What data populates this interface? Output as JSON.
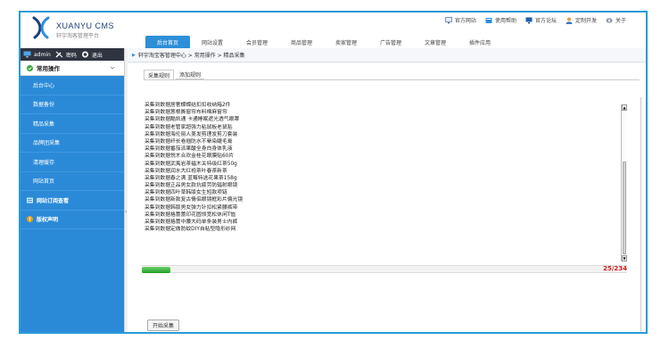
{
  "app": {
    "logo_name": "XUANYU CMS",
    "logo_sub": "轩宇淘客管理平台"
  },
  "toplinks": [
    {
      "label": "官方网站",
      "icon": "monitor-icon"
    },
    {
      "label": "使用帮助",
      "icon": "book-icon"
    },
    {
      "label": "官方论坛",
      "icon": "forum-icon"
    },
    {
      "label": "定制开发",
      "icon": "user-icon"
    },
    {
      "label": "关于",
      "icon": "info-icon"
    }
  ],
  "nav_tabs": [
    "后台首页",
    "网站设置",
    "会员管理",
    "商品管理",
    "卖家管理",
    "广告管理",
    "文章管理",
    "插件应用"
  ],
  "userbar": {
    "user": "admin",
    "password": "密码",
    "logout": "退出"
  },
  "menu_head": "常用操作",
  "menu_items": [
    {
      "label": "后台中心",
      "type": "plain"
    },
    {
      "label": "数据备份",
      "type": "plain"
    },
    {
      "label": "精品采集",
      "type": "plain"
    },
    {
      "label": "品牌团采集",
      "type": "plain"
    },
    {
      "label": "清理缓存",
      "type": "plain"
    },
    {
      "label": "网站首页",
      "type": "plain"
    },
    {
      "label": "网站订阅查看",
      "type": "section"
    },
    {
      "label": "版权声明",
      "type": "section"
    }
  ],
  "breadcrumb": "轩宇淘宝客管理中心 > 常用操作 > 精品采集",
  "subtabs": [
    "采集规则",
    "添加规则"
  ],
  "log_lines": [
    "采集到数据居奢蝶蝶结扣扣收纳箱2件",
    "采集到数据蒽根撕窗帘布料棉麻窗帘",
    "采集到数据酷凯通 卡通睡眠遮光透气眼罩",
    "采集到数据老管家超强力粘鼠板老鼠贴",
    "采集到数据海伦丽人美发剪理发剪刀套装",
    "采集到数据纤长卷翘防水不晕染睫毛膏",
    "采集到数据番茄派果酸全身白身体乳液",
    "采集到数据悦木合欢金桂花眼膜贴60片",
    "采集到数据武夷岩茶福木关特级红茶50g",
    "采集到数据润水大红袍茶叶春茶新茶",
    "采集到数据春之满 蓝莓特选花果茶158g",
    "采集到数据正品男女款抗疲劳防辐射眼镜",
    "采集到数据四叶草韩版女生短款项链",
    "采集到数据新款复古情侣眼镜框彩片偏光镜",
    "采集到数据韩版男女弹力针扣松紧腰裤带",
    "采集到数据格蕾蕾印花圆领宽松休闲T恤",
    "采集到数据格蕾中腰大码单条装男士内裤",
    "采集到数据定做防蚊DIY自粘型隐形纱网"
  ],
  "progress": {
    "current": 25,
    "total": 234,
    "text": "25/234"
  },
  "start_button": "开始采集",
  "colors": {
    "accent": "#2d8fd8",
    "sidebar": "#2b8ad8",
    "progress": "#1e9f25",
    "progress_text": "#d0201b"
  }
}
